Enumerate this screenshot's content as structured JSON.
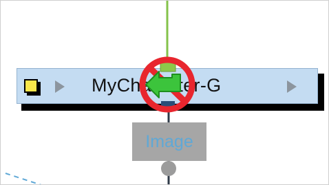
{
  "node": {
    "title": "MyCharacter-G",
    "icon": "yellow-square-icon",
    "play_left_icon": "play-icon",
    "play_right_icon": "play-icon"
  },
  "image_node": {
    "label": "Image"
  },
  "highlight": {
    "icon": "undo-arrow-icon",
    "ring_color": "#e8262e",
    "arrow_color": "#3cc43c"
  },
  "colors": {
    "connector": "#84c24a",
    "node_bg": "#c4dcf2",
    "image_node_bg": "#a6a6a6"
  }
}
